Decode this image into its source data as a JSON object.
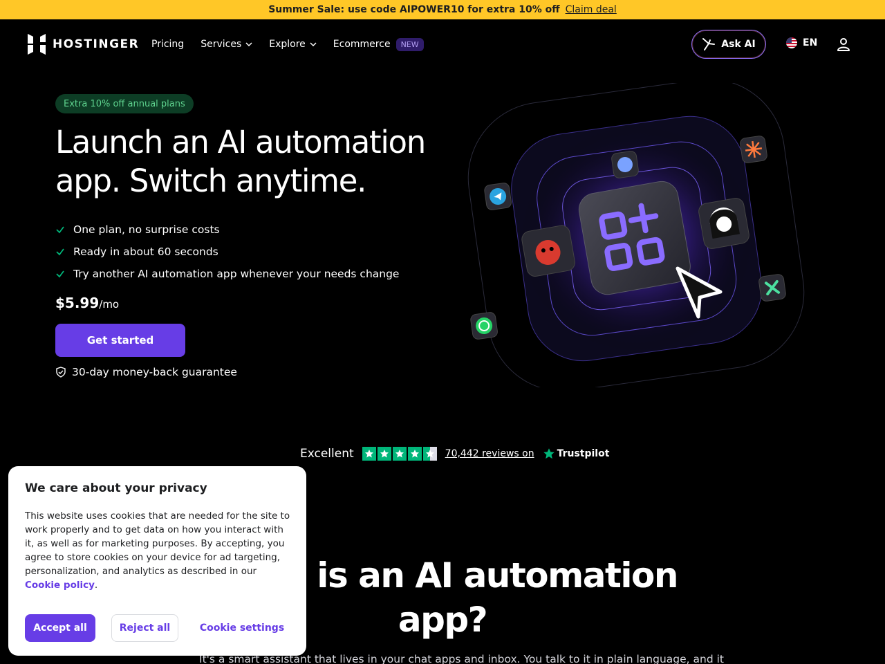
{
  "promo": {
    "text": "Summer Sale: use code AIPOWER10 for extra 10% off",
    "link": "Claim deal"
  },
  "nav": {
    "logo": "HOSTINGER",
    "links": [
      "Pricing",
      "Services",
      "Explore",
      "Ecommerce"
    ],
    "new_badge": "NEW",
    "ask_ai": "Ask AI",
    "language": "EN"
  },
  "hero": {
    "pill": "Extra 10% off annual plans",
    "title": "Launch an AI automation app. Switch anytime.",
    "features": [
      "One plan, no surprise costs",
      "Ready in about 60 seconds",
      "Try another AI automation app whenever your needs change"
    ],
    "price": "$5.99",
    "price_unit": "/mo",
    "cta": "Get started",
    "guarantee": "30-day money-back guarantee"
  },
  "trust": {
    "rating_word": "Excellent",
    "rating_stars": 4.5,
    "reviews": "70,442 reviews on",
    "brand": "Trustpilot"
  },
  "section": {
    "title": "What is an AI automation app?",
    "description": "It's a smart assistant that lives in your chat apps and inbox. You talk to it in plain language, and it"
  },
  "cookie": {
    "title": "We care about your privacy",
    "body": "This website uses cookies that are needed for the site to work properly and to get data on how you interact with it, as well as for marketing purposes. By accepting, you agree to store cookies on your device for ad targeting, personalization, and analytics as described in our",
    "policy_link": "Cookie policy",
    "accept": "Accept all",
    "reject": "Reject all",
    "settings": "Cookie settings"
  },
  "colors": {
    "promo_bg": "#ffc727",
    "primary": "#673de6",
    "success": "#00b67a",
    "background": "#000000"
  },
  "icons": [
    "hostinger-logo",
    "chevron-down-icon",
    "ask-ai-icon",
    "us-flag-icon",
    "user-icon",
    "check-icon",
    "shield-check-icon",
    "star-icon",
    "telegram-icon",
    "whatsapp-icon",
    "app-grid-icon",
    "cursor-icon"
  ]
}
